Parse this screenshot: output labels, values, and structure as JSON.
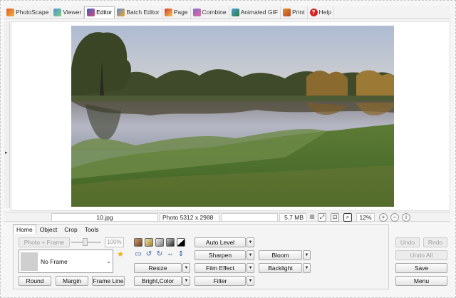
{
  "menu": [
    {
      "label": "PhotoScape",
      "icon": "photoscape-icon",
      "active": false
    },
    {
      "label": "Viewer",
      "icon": "viewer-icon",
      "active": false
    },
    {
      "label": "Editor",
      "icon": "editor-icon",
      "active": true
    },
    {
      "label": "Batch Editor",
      "icon": "batch-editor-icon",
      "active": false
    },
    {
      "label": "Page",
      "icon": "page-icon",
      "active": false
    },
    {
      "label": "Combine",
      "icon": "combine-icon",
      "active": false
    },
    {
      "label": "Animated GIF",
      "icon": "animated-gif-icon",
      "active": false
    },
    {
      "label": "Print",
      "icon": "print-icon",
      "active": false
    },
    {
      "label": "Help",
      "icon": "help-icon",
      "active": false
    }
  ],
  "help_glyph": "?",
  "left_handle_glyph": "▸",
  "status": {
    "filename": "10.jpg",
    "dimensions": "Photo 5312 x 2988",
    "filesize": "5.7 MB",
    "zoom": "12%"
  },
  "tabs": [
    "Home",
    "Object",
    "Crop",
    "Tools"
  ],
  "active_tab": "Home",
  "home": {
    "photo_frame_label": "Photo + Frame",
    "opacity_value": "100%",
    "frame_selected": "No Frame",
    "round_label": "Round",
    "margin_label": "Margin",
    "frame_line_label": "Frame Line",
    "resize_label": "Resize",
    "bright_color_label": "Bright,Color",
    "auto_level_label": "Auto Level",
    "sharpen_label": "Sharpen",
    "film_effect_label": "Film Effect",
    "filter_label": "Filter",
    "bloom_label": "Bloom",
    "backlight_label": "Backlight"
  },
  "actions": {
    "undo_label": "Undo",
    "redo_label": "Redo",
    "undo_all_label": "Undo All",
    "save_label": "Save",
    "menu_label": "Menu"
  },
  "colors": {
    "accent": "#2b5ea8",
    "star": "#f0b400"
  }
}
